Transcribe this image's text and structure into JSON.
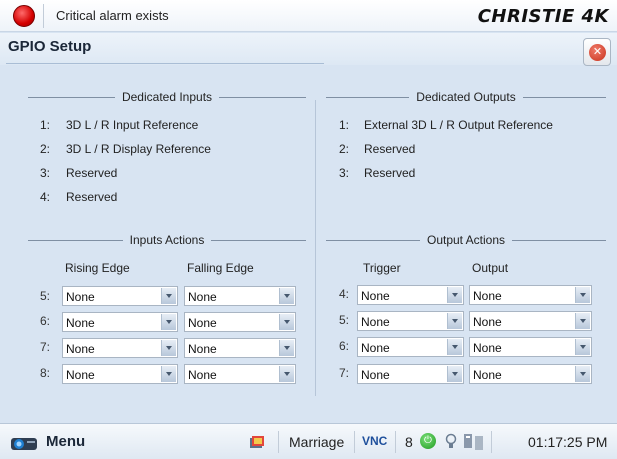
{
  "topbar": {
    "alarm_text": "Critical alarm exists",
    "brand": "CHRISTIE 4K",
    "alarm_color": "#d40000"
  },
  "window": {
    "title": "GPIO Setup",
    "close_icon": "close-icon"
  },
  "dedicated_inputs": {
    "heading": "Dedicated Inputs",
    "items": [
      {
        "num": "1:",
        "label": "3D L / R Input Reference"
      },
      {
        "num": "2:",
        "label": "3D L / R Display Reference"
      },
      {
        "num": "3:",
        "label": "Reserved"
      },
      {
        "num": "4:",
        "label": "Reserved"
      }
    ]
  },
  "dedicated_outputs": {
    "heading": "Dedicated Outputs",
    "items": [
      {
        "num": "1:",
        "label": "External 3D L / R Output Reference"
      },
      {
        "num": "2:",
        "label": "Reserved"
      },
      {
        "num": "3:",
        "label": "Reserved"
      }
    ]
  },
  "inputs_actions": {
    "heading": "Inputs Actions",
    "col1": "Rising Edge",
    "col2": "Falling Edge",
    "rows": [
      {
        "num": "5:",
        "rising": "None",
        "falling": "None"
      },
      {
        "num": "6:",
        "rising": "None",
        "falling": "None"
      },
      {
        "num": "7:",
        "rising": "None",
        "falling": "None"
      },
      {
        "num": "8:",
        "rising": "None",
        "falling": "None"
      }
    ]
  },
  "output_actions": {
    "heading": "Output Actions",
    "col1": "Trigger",
    "col2": "Output",
    "rows": [
      {
        "num": "4:",
        "trigger": "None",
        "output": "None"
      },
      {
        "num": "5:",
        "trigger": "None",
        "output": "None"
      },
      {
        "num": "6:",
        "trigger": "None",
        "output": "None"
      },
      {
        "num": "7:",
        "trigger": "None",
        "output": "None"
      }
    ]
  },
  "taskbar": {
    "menu_label": "Menu",
    "channel": "Marriage",
    "vnc": "VNC",
    "count": "8",
    "time": "01:17:25 PM",
    "icons": [
      "projector-icon",
      "channel-icon",
      "power-icon",
      "bulb-icon",
      "network-icon"
    ]
  }
}
